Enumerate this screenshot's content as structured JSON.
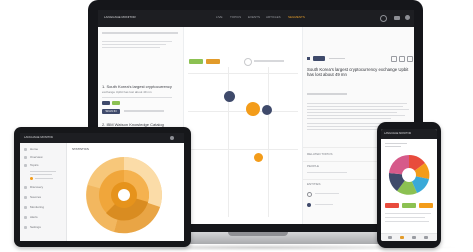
{
  "laptop": {
    "brand": "LANGUAGE MONITOR",
    "nav": [
      "LIVE",
      "TOPICS",
      "EVENTS",
      "ARTICLES",
      "SEGMENTS"
    ],
    "nav_active_index": 4,
    "filter_chips": [
      {
        "color": "#8cc152"
      },
      {
        "color": "#e29b2a"
      }
    ],
    "list_items": [
      {
        "text": "1. South Korea's largest cryptocurrency",
        "sub": "exchange Upbit has lost about 49 mn"
      },
      {
        "text": "2. IBM Watson Knowledge Catalog",
        "sub": "The latest data and analytic services"
      }
    ],
    "list_button": "SIGN IN",
    "headline": "South Korea's largest cryptocurrency exchange Upbit has lost about 49 mn",
    "detail_labels": [
      "RELATED TOPICS",
      "PEOPLE",
      "ENTITIES"
    ],
    "bubble_colors": {
      "orange": "#f39c1a",
      "navy": "#3f4a6b"
    }
  },
  "tablet": {
    "brand": "LANGUAGE MONITOR",
    "title": "STATISTICS",
    "menu": [
      "Home",
      "Overview",
      "Topics",
      "Discovery",
      "Sources",
      "Monitoring",
      "Alerts",
      "Settings"
    ]
  },
  "phone": {
    "brand": "LANGUAGE MONITOR"
  }
}
